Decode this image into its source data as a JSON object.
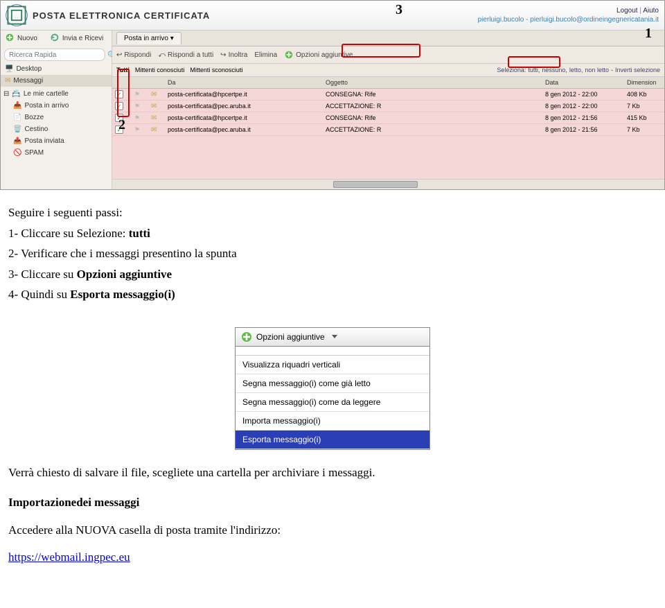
{
  "webmail": {
    "brand_title": "POSTA ELETTRONICA CERTIFICATA",
    "top_links": {
      "logout": "Logout",
      "sep": "|",
      "help": "Aiuto"
    },
    "user_label": "pierluigi.bucolo - pierluigi.bucolo@ordineingegnericatania.it",
    "toolbar_left": {
      "nuovo": "Nuovo",
      "invia": "Invia e Ricevi"
    },
    "search_placeholder": "Ricerca Rapida",
    "sidebar": {
      "desktop": "Desktop",
      "messaggi": "Messaggi",
      "root": "Le mie cartelle",
      "folders": [
        "Posta in arrivo",
        "Bozze",
        "Cestino",
        "Posta inviata",
        "SPAM"
      ]
    },
    "tabs": [
      "Posta in arrivo"
    ],
    "msg_toolbar": {
      "rispondi": "Rispondi",
      "rispondi_tutti": "Rispondi a tutti",
      "inoltra": "Inoltra",
      "elimina": "Elimina",
      "opzioni": "Opzioni aggiuntive"
    },
    "filters": {
      "tutti": "Tutti",
      "conosciuti": "Mittenti conosciuti",
      "sconosciuti": "Mittenti sconosciuti"
    },
    "selection": {
      "label": "Seleziona:",
      "all": "tutti,",
      "none": "nessuno,",
      "read": "letto,",
      "unread": "non letto",
      "invert": "Inverti selezione",
      "dash": " - "
    },
    "grid_head": {
      "from": "Da",
      "subj": "Oggetto",
      "date": "Data",
      "size": "Dimension"
    },
    "rows": [
      {
        "from": "posta-certificata@hpcertpe.it",
        "subj": "CONSEGNA: Rife",
        "date": "8 gen 2012 - 22:00",
        "size": "408 Kb"
      },
      {
        "from": "posta-certificata@pec.aruba.it",
        "subj": "ACCETTAZIONE: R",
        "date": "8 gen 2012 - 22:00",
        "size": "7 Kb"
      },
      {
        "from": "posta-certificata@hpcertpe.it",
        "subj": "CONSEGNA: Rife",
        "date": "8 gen 2012 - 21:56",
        "size": "415 Kb"
      },
      {
        "from": "posta-certificata@pec.aruba.it",
        "subj": "ACCETTAZIONE: R",
        "date": "8 gen 2012 - 21:56",
        "size": "7 Kb"
      }
    ],
    "annot": {
      "n1": "1",
      "n2": "2",
      "n3": "3"
    }
  },
  "doc": {
    "intro": "Seguire i seguenti passi:",
    "step1_a": "1- Cliccare su Selezione: ",
    "step1_b": "tutti",
    "step2": "2- Verificare che i messaggi presentino la spunta",
    "step3_a": "3- Cliccare su ",
    "step3_b": "Opzioni aggiuntive",
    "step4_a": "4- Quindi su ",
    "step4_b": "Esporta messaggio(i)",
    "after": "Verrà chiesto di salvare il file, scegliete una cartella per archiviare i messaggi.",
    "heading": "Importazionedei messaggi",
    "access": "Accedere alla NUOVA casella di posta tramite l'indirizzo:",
    "url": "https://webmail.ingpec.eu"
  },
  "dropdown": {
    "button": "Opzioni aggiuntive",
    "items": [
      "Visualizza riquadri verticali",
      "Segna messaggio(i) come già letto",
      "Segna messaggio(i) come da leggere",
      "Importa messaggio(i)",
      "Esporta messaggio(i)"
    ],
    "selected_index": 4
  }
}
